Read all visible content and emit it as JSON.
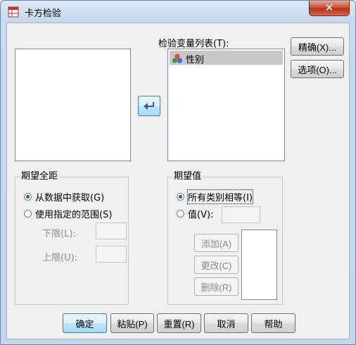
{
  "window": {
    "title": "卡方检验",
    "close_symbol": "✕"
  },
  "test_variables": {
    "label": "检验变量列表(T):",
    "items": [
      {
        "label": "性别"
      }
    ]
  },
  "side_buttons": {
    "exact": "精确(X)...",
    "options": "选项(O)..."
  },
  "move_button": {
    "symbol": "➜"
  },
  "expected_range": {
    "title": "期望全距",
    "from_data": "从数据中获取(G)",
    "use_range": "使用指定的范围(S)",
    "lower_label": "下限(L):",
    "upper_label": "上限(U):",
    "selected": "from_data"
  },
  "expected_values": {
    "title": "期望值",
    "all_equal": "所有类别相等(I)",
    "values_label": "值(V):",
    "add": "添加(A)",
    "change": "更改(C)",
    "remove": "删除(R)",
    "selected": "all_equal"
  },
  "bottom_buttons": {
    "ok": "确定",
    "paste": "粘贴(P)",
    "reset": "重置(R)",
    "cancel": "取消",
    "help": "帮助"
  }
}
